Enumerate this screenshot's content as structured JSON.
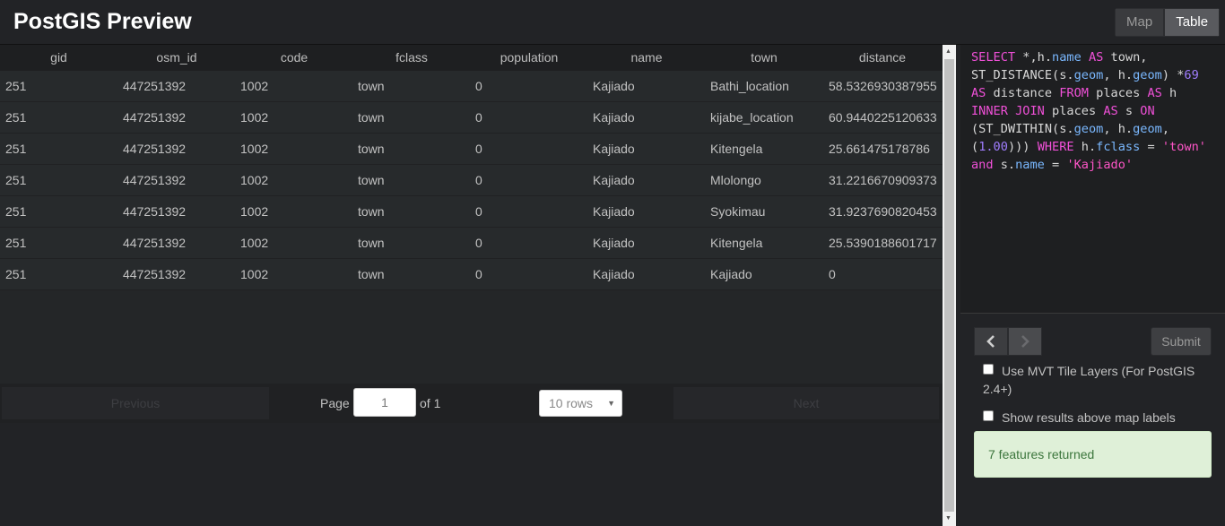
{
  "app": {
    "title": "PostGIS Preview"
  },
  "view_toggle": {
    "map_label": "Map",
    "table_label": "Table",
    "active": "Table"
  },
  "table": {
    "columns": [
      "gid",
      "osm_id",
      "code",
      "fclass",
      "population",
      "name",
      "town",
      "distance"
    ],
    "rows": [
      [
        "251",
        "447251392",
        "1002",
        "town",
        "0",
        "Kajiado",
        "Bathi_location",
        "58.5326930387955"
      ],
      [
        "251",
        "447251392",
        "1002",
        "town",
        "0",
        "Kajiado",
        "kijabe_location",
        "60.9440225120633"
      ],
      [
        "251",
        "447251392",
        "1002",
        "town",
        "0",
        "Kajiado",
        "Kitengela",
        "25.661475178786"
      ],
      [
        "251",
        "447251392",
        "1002",
        "town",
        "0",
        "Kajiado",
        "Mlolongo",
        "31.2216670909373"
      ],
      [
        "251",
        "447251392",
        "1002",
        "town",
        "0",
        "Kajiado",
        "Syokimau",
        "31.9237690820453"
      ],
      [
        "251",
        "447251392",
        "1002",
        "town",
        "0",
        "Kajiado",
        "Kitengela",
        "25.5390188601717"
      ],
      [
        "251",
        "447251392",
        "1002",
        "town",
        "0",
        "Kajiado",
        "Kajiado",
        "0"
      ]
    ]
  },
  "pager": {
    "previous_label": "Previous",
    "page_label": "Page",
    "page_value": "1",
    "of_label": "of 1",
    "rows_selected": "10 rows",
    "next_label": "Next"
  },
  "query": {
    "tokens": [
      [
        [
          "kw",
          "SELECT"
        ],
        [
          "t",
          " *,h."
        ],
        [
          "prop",
          "name"
        ],
        [
          "t",
          " "
        ],
        [
          "kw",
          "AS"
        ],
        [
          "t",
          " town,"
        ]
      ],
      [
        [
          "t",
          "ST_DISTANCE(s."
        ],
        [
          "prop",
          "geom"
        ],
        [
          "t",
          ", h."
        ],
        [
          "prop",
          "geom"
        ],
        [
          "t",
          ") *"
        ],
        [
          "num",
          "69"
        ]
      ],
      [
        [
          "kw",
          "AS"
        ],
        [
          "t",
          " distance "
        ],
        [
          "kw",
          "FROM"
        ],
        [
          "t",
          " places "
        ],
        [
          "kw",
          "AS"
        ],
        [
          "t",
          " h"
        ]
      ],
      [
        [
          "kw",
          "INNER JOIN"
        ],
        [
          "t",
          " places "
        ],
        [
          "kw",
          "AS"
        ],
        [
          "t",
          " s "
        ],
        [
          "kw",
          "ON"
        ]
      ],
      [
        [
          "t",
          "(ST_DWITHIN(s."
        ],
        [
          "prop",
          "geom"
        ],
        [
          "t",
          ", h."
        ],
        [
          "prop",
          "geom"
        ],
        [
          "t",
          ","
        ]
      ],
      [
        [
          "t",
          "("
        ],
        [
          "num",
          "1.00"
        ],
        [
          "t",
          ")))"
        ],
        [
          "t",
          " "
        ],
        [
          "kw",
          "WHERE"
        ],
        [
          "t",
          " h."
        ],
        [
          "prop",
          "fclass"
        ],
        [
          "t",
          " = "
        ],
        [
          "str",
          "'town'"
        ]
      ],
      [
        [
          "kw",
          "and"
        ],
        [
          "t",
          " s."
        ],
        [
          "prop",
          "name"
        ],
        [
          "t",
          " = "
        ],
        [
          "str",
          "'Kajiado'"
        ]
      ]
    ]
  },
  "controls": {
    "prev_icon": "chevron-left-icon",
    "next_icon": "chevron-right-icon",
    "submit_label": "Submit",
    "mvt_label": "Use MVT Tile Layers (For PostGIS 2.4+)",
    "above_labels_label": "Show results above map labels",
    "status_text": "7 features returned"
  },
  "colors": {
    "status_bg": "#dff0d8",
    "status_text": "#3c763d",
    "keyword": "#f050d8"
  }
}
